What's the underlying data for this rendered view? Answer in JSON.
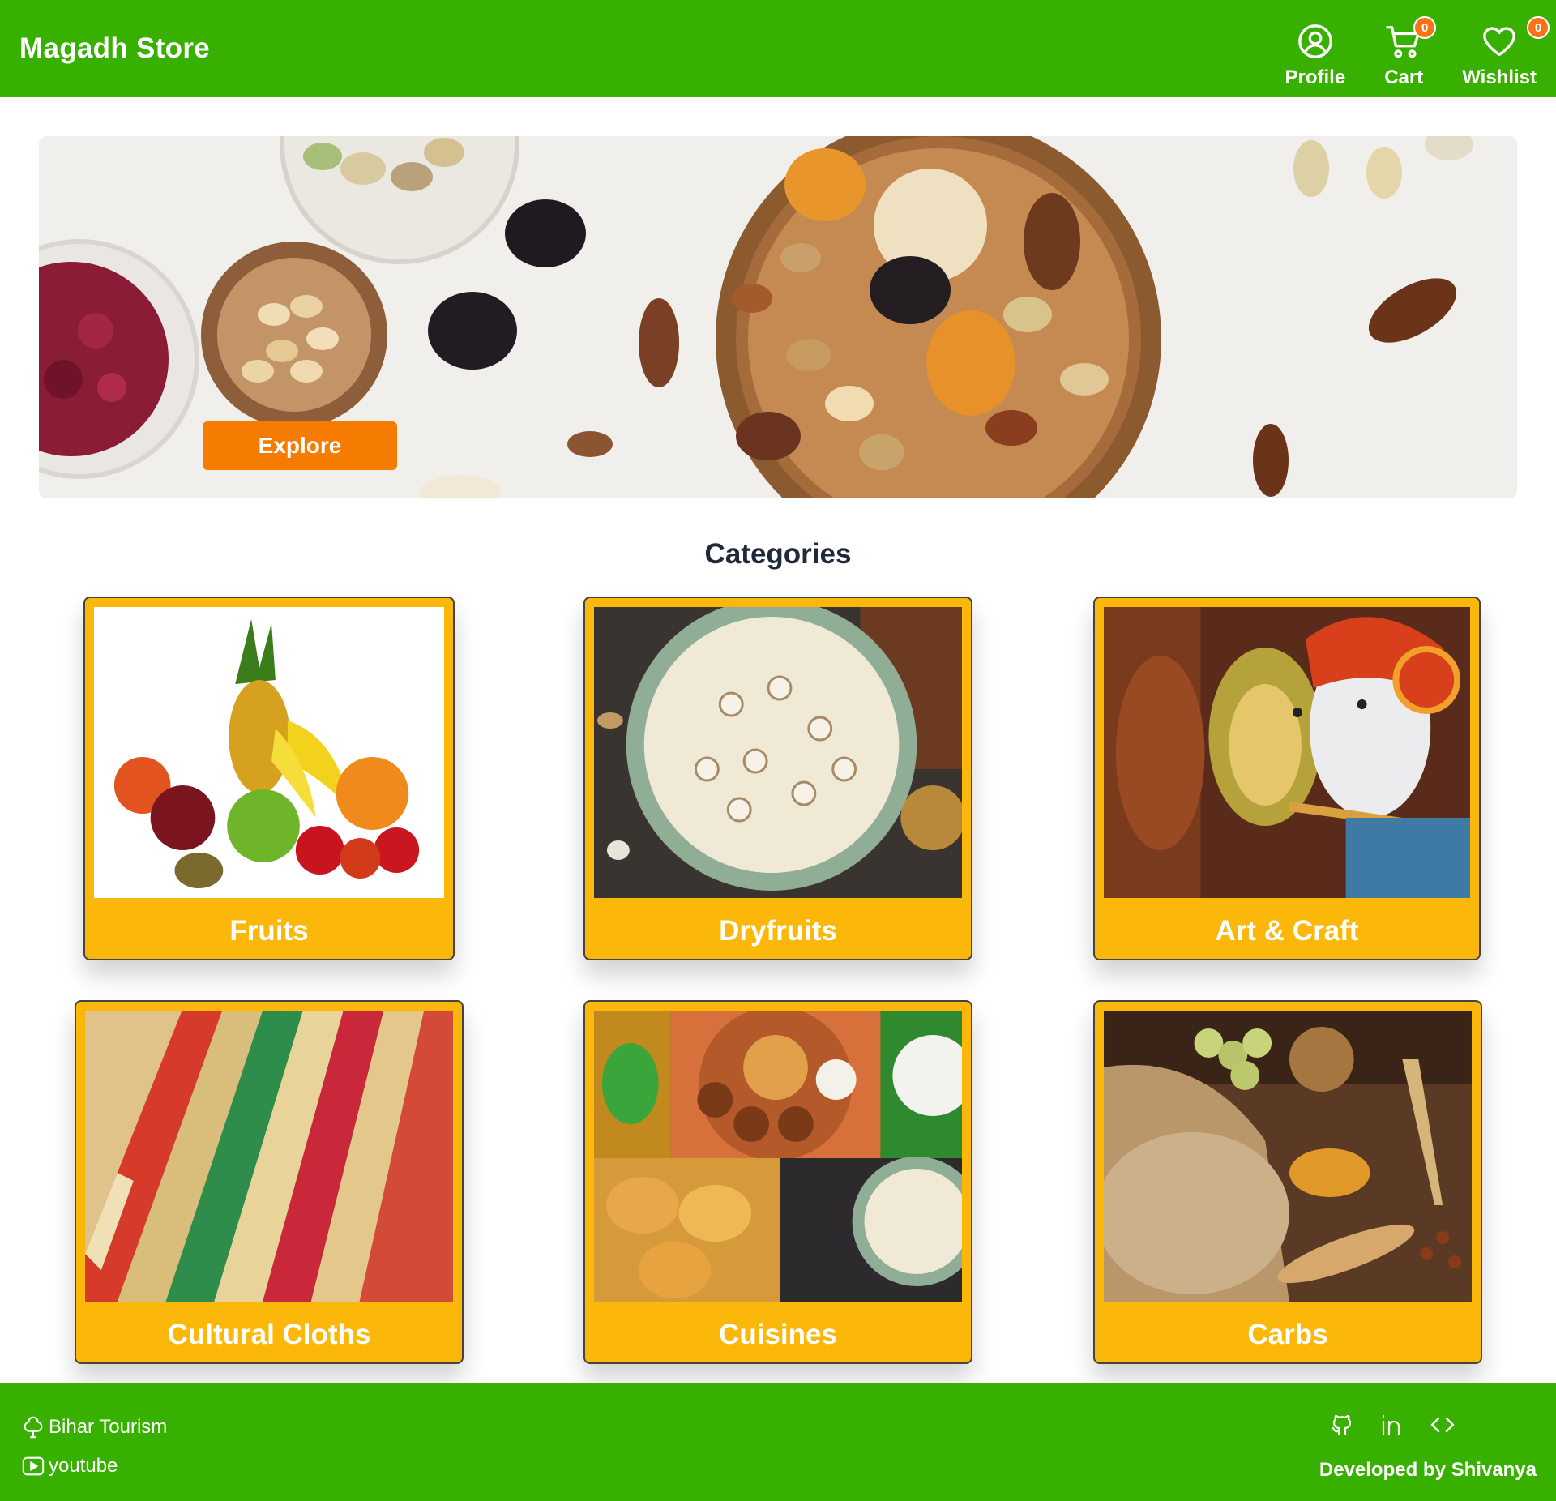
{
  "header": {
    "brand": "Magadh Store",
    "nav": [
      {
        "label": "Profile",
        "icon": "profile-icon"
      },
      {
        "label": "Cart",
        "icon": "cart-icon",
        "count": "0"
      },
      {
        "label": "Wishlist",
        "icon": "heart-icon",
        "count": "0"
      }
    ]
  },
  "banner": {
    "cta_label": "Explore"
  },
  "categories": {
    "title": "Categories",
    "items": [
      {
        "label": "Fruits"
      },
      {
        "label": "Dryfruits"
      },
      {
        "label": "Art & Craft"
      },
      {
        "label": "Cultural Cloths"
      },
      {
        "label": "Cuisines"
      },
      {
        "label": "Carbs"
      }
    ]
  },
  "footer": {
    "links": [
      {
        "label": "Bihar Tourism",
        "icon": "tree-icon"
      },
      {
        "label": "youtube",
        "icon": "youtube-icon"
      }
    ],
    "social_icons": [
      "github-icon",
      "linkedin-icon",
      "code-icon"
    ],
    "credit": "Developed by Shivanya"
  },
  "colors": {
    "primary": "#38b000",
    "card": "#fbb80a",
    "cta": "#f57c00",
    "badge": "#f97316"
  }
}
